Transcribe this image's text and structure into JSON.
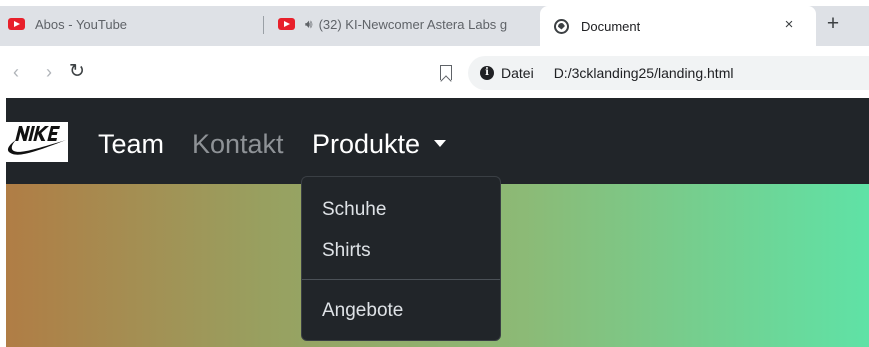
{
  "browser": {
    "tabs": [
      {
        "title": "Abos - YouTube",
        "icon": "youtube-icon"
      },
      {
        "title": "(32) KI-Newcomer Astera Labs g",
        "icon": "youtube-icon",
        "audio": "speaker-icon"
      },
      {
        "title": "Document",
        "icon": "globe-icon",
        "active": true
      }
    ],
    "close_label": "×",
    "new_tab_label": "+",
    "toolbar": {
      "back_label": "‹",
      "forward_label": "›",
      "reload_label": "↻",
      "security_label": "Datei",
      "url": "D:/3cklanding25/landing.html"
    }
  },
  "site": {
    "brand": "NIKE",
    "nav": {
      "team": "Team",
      "kontakt": "Kontakt",
      "produkte": "Produkte"
    },
    "dropdown": {
      "items": [
        "Schuhe",
        "Shirts",
        "Angebote"
      ]
    },
    "colors": {
      "navbar": "#212529",
      "gradient_start": "#b07d45",
      "gradient_end": "#5fe2a6"
    }
  }
}
